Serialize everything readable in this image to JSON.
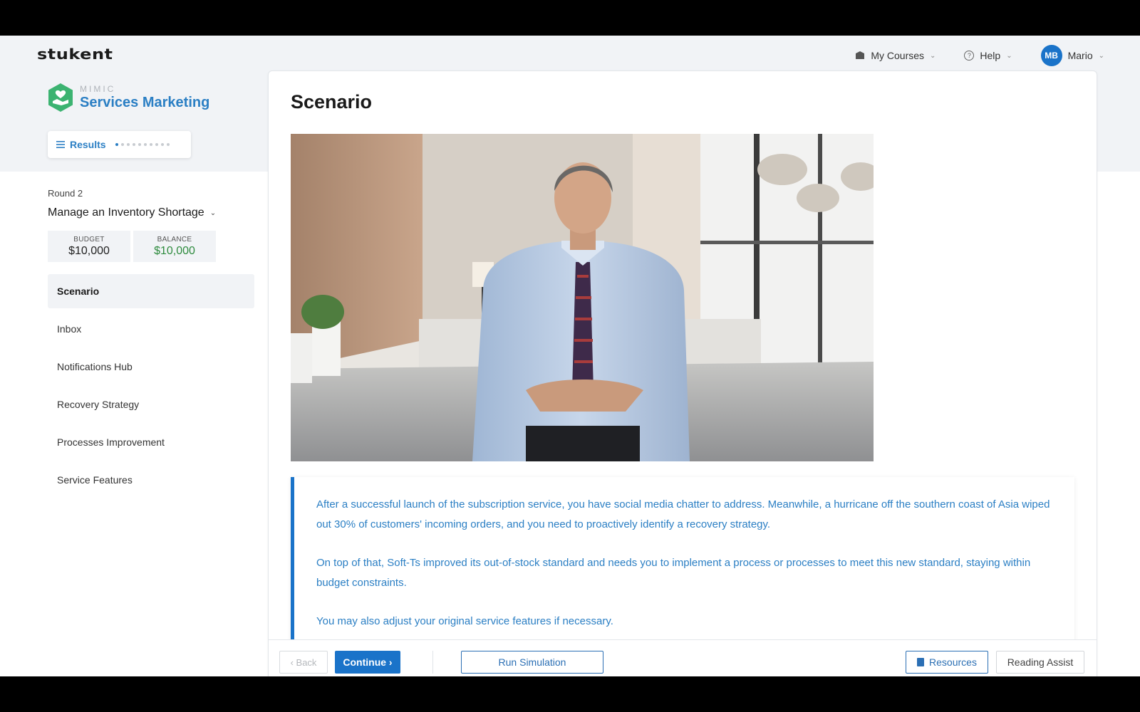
{
  "app": {
    "logo_text": "STUKENT"
  },
  "topnav": {
    "my_courses": "My Courses",
    "help": "Help",
    "user_initials": "MB",
    "user_name": "Mario"
  },
  "brand": {
    "super_title": "MIMIC",
    "title": "Services Marketing",
    "accent_color": "#2b7fc4",
    "logo_color": "#3cb371"
  },
  "results": {
    "label": "Results",
    "step_total": 10,
    "step_current": 1
  },
  "round": {
    "label": "Round 2",
    "title": "Manage an Inventory Shortage"
  },
  "budget": {
    "budget_label": "BUDGET",
    "budget_value": "$10,000",
    "balance_label": "BALANCE",
    "balance_value": "$10,000"
  },
  "sidebar": {
    "items": [
      {
        "label": "Scenario",
        "active": true
      },
      {
        "label": "Inbox",
        "active": false
      },
      {
        "label": "Notifications Hub",
        "active": false
      },
      {
        "label": "Recovery Strategy",
        "active": false
      },
      {
        "label": "Processes Improvement",
        "active": false
      },
      {
        "label": "Service Features",
        "active": false
      }
    ]
  },
  "main": {
    "title": "Scenario",
    "paragraphs": [
      "After a successful launch of the subscription service, you have social media chatter to address. Meanwhile, a hurricane off the southern coast of Asia wiped out 30% of customers' incoming orders, and you need to proactively identify a recovery strategy.",
      "On top of that, Soft-Ts improved its out-of-stock standard and needs you to implement a process or processes to meet this new standard, staying within budget constraints.",
      "You may also adjust your original service features if necessary."
    ]
  },
  "footer": {
    "back": "‹ Back",
    "continue": "Continue ›",
    "run_simulation": "Run Simulation",
    "resources": "Resources",
    "reading_assist": "Reading Assist"
  }
}
